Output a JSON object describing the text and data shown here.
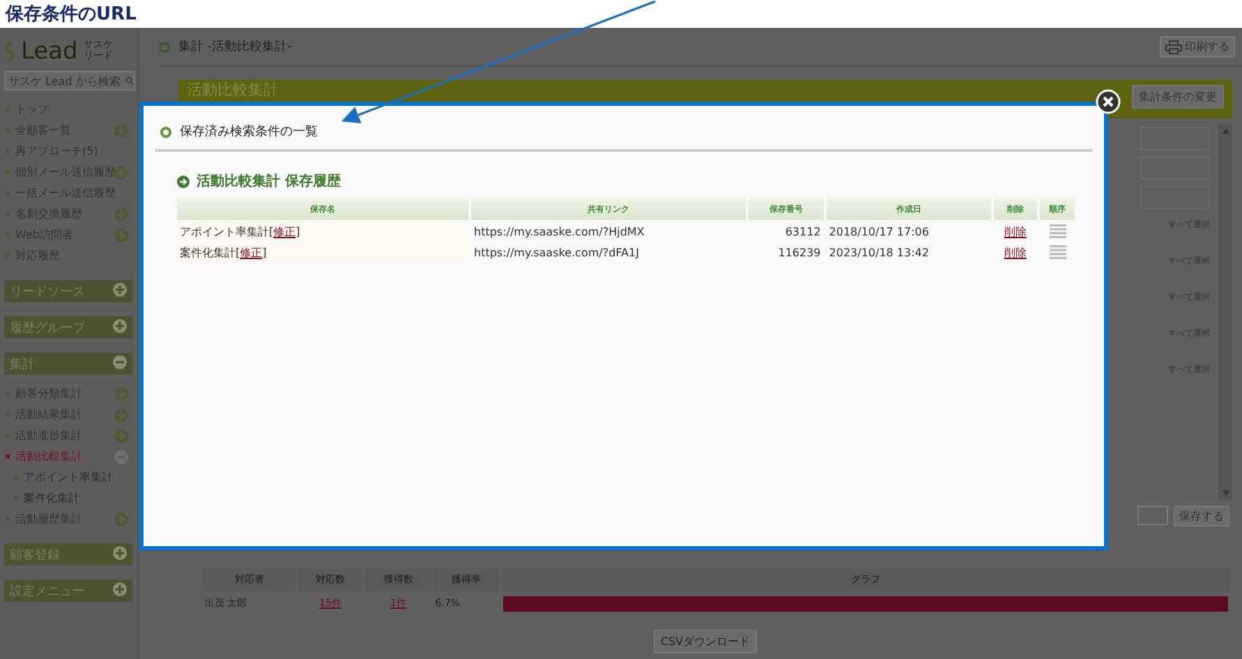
{
  "annotation": {
    "caption": "保存条件のURL"
  },
  "sidebar": {
    "logo": "Lead",
    "logo_sub": [
      "サスケ",
      "リード"
    ],
    "search": {
      "placeholder": "サスケ Lead から検索"
    },
    "items": [
      {
        "kind": "link",
        "label": "トップ",
        "toggle": false,
        "selected": false
      },
      {
        "kind": "link",
        "label": "全顧客一覧",
        "toggle": true,
        "selected": false
      },
      {
        "kind": "link",
        "label": "再アプローチ(5)",
        "toggle": false,
        "selected": false
      },
      {
        "kind": "link",
        "label": "個別メール送信履歴",
        "toggle": true,
        "selected": false
      },
      {
        "kind": "link",
        "label": "一括メール送信履歴",
        "toggle": false,
        "selected": false
      },
      {
        "kind": "link",
        "label": "名刺交換履歴",
        "toggle": true,
        "selected": false
      },
      {
        "kind": "link",
        "label": "Web訪問者",
        "toggle": true,
        "selected": false
      },
      {
        "kind": "link",
        "label": "対応履歴",
        "toggle": false,
        "selected": false
      },
      {
        "kind": "section",
        "label": "リードソース",
        "expanded": false
      },
      {
        "kind": "section",
        "label": "履歴グループ",
        "expanded": false
      },
      {
        "kind": "section",
        "label": "集計",
        "expanded": true,
        "children": [
          {
            "kind": "link",
            "label": "顧客分類集計",
            "toggle": true,
            "selected": false
          },
          {
            "kind": "link",
            "label": "活動結果集計",
            "toggle": true,
            "selected": false
          },
          {
            "kind": "link",
            "label": "活動進捗集計",
            "toggle": true,
            "selected": false
          },
          {
            "kind": "link",
            "label": "活動比較集計",
            "toggle": true,
            "selected": true,
            "children": [
              {
                "kind": "link",
                "label": "アポイント率集計",
                "toggle": false,
                "selected": false
              },
              {
                "kind": "link",
                "label": "案件化集計",
                "toggle": false,
                "selected": false
              }
            ]
          },
          {
            "kind": "link",
            "label": "活動履歴集計",
            "toggle": true,
            "selected": false
          }
        ]
      },
      {
        "kind": "section",
        "label": "顧客登録",
        "expanded": false
      },
      {
        "kind": "section",
        "label": "設定メニュー",
        "expanded": false
      }
    ]
  },
  "header": {
    "title": "集計 -活動比較集計-",
    "print_button": "印刷する"
  },
  "banner": {
    "title": "活動比較集計",
    "change_button": "集計条件の変更"
  },
  "filter_panel": {
    "select_all_links": [
      "すべて選択",
      "すべて選択",
      "すべて選択",
      "すべて選択",
      "すべて選択"
    ],
    "save_button": "保存する"
  },
  "results": {
    "columns": [
      "対応者",
      "対応数",
      "獲得数",
      "獲得率",
      "グラフ"
    ],
    "rows": [
      {
        "name": "出茂 太郎",
        "count": "15件",
        "acquired": "1件",
        "rate": "6.7%",
        "level": 1
      }
    ],
    "csv_button": "CSVダウンロード"
  },
  "modal": {
    "title": "保存済み検索条件の一覧",
    "section_title": "活動比較集計 保存履歴",
    "columns": [
      "保存名",
      "共有リンク",
      "保存番号",
      "作成日",
      "削除",
      "順序"
    ],
    "rows": [
      {
        "name": "アポイント率集計[",
        "edit_link": "修正",
        "name_end": "]",
        "url": "https://my.saaske.com/?HjdMX",
        "number": "63112",
        "created": "2018/10/17 17:06",
        "delete_link": "削除"
      },
      {
        "name": "案件化集計[",
        "edit_link": "修正",
        "name_end": "]",
        "url": "https://my.saaske.com/?dFA1J",
        "number": "116239",
        "created": "2023/10/18 13:42",
        "delete_link": "削除"
      }
    ]
  }
}
